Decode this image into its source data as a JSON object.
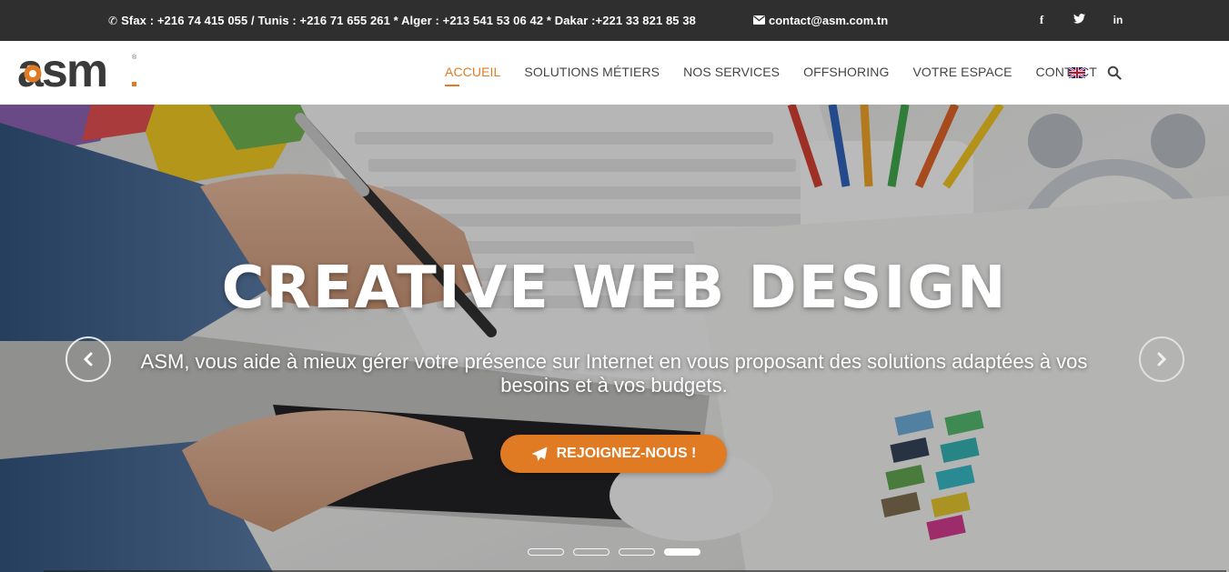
{
  "topbar": {
    "phones": "Sfax : +216 74 415 055 / Tunis : +216 71 655 261 * Alger : +213 541 53 06 42 * Dakar :+221 33 821 85 38",
    "email": "contact@asm.com.tn",
    "phone_icon": "phone-icon",
    "mail_icon": "envelope-icon",
    "social": [
      {
        "icon": "facebook-icon",
        "glyph": "f"
      },
      {
        "icon": "twitter-icon",
        "glyph": "twitter"
      },
      {
        "icon": "linkedin-icon",
        "glyph": "in"
      }
    ],
    "background": "#2f2f2f"
  },
  "header": {
    "logo_text": "asm",
    "nav": [
      {
        "label": "ACCUEIL",
        "active": true
      },
      {
        "label": "SOLUTIONS MÉTIERS",
        "active": false
      },
      {
        "label": "NOS SERVICES",
        "active": false
      },
      {
        "label": "OFFSHORING",
        "active": false
      },
      {
        "label": "VOTRE ESPACE",
        "active": false
      },
      {
        "label": "CONTACT",
        "active": false
      }
    ],
    "language_icon": "uk-flag-icon",
    "search_icon": "search-icon",
    "accent": "#e07b24"
  },
  "hero": {
    "title": "CREATIVE WEB DESIGN",
    "subtitle": "ASM, vous aide à mieux gérer votre présence sur Internet en vous proposant des solutions adaptées à vos besoins et à vos budgets.",
    "cta_label": "REJOIGNEZ-NOUS !",
    "cta_icon": "paper-plane-icon",
    "prev_icon": "chevron-left-icon",
    "next_icon": "chevron-right-icon",
    "slides_count": 4,
    "active_slide": 4,
    "cta_color": "#e07b24"
  }
}
